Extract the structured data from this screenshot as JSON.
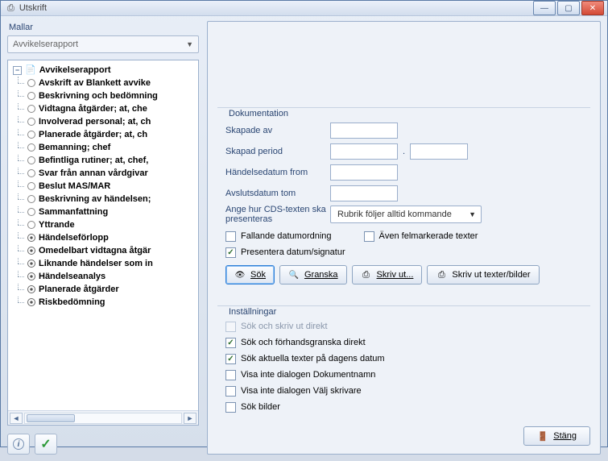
{
  "window": {
    "title": "Utskrift"
  },
  "mallar": {
    "label": "Mallar",
    "selected": "Avvikelserapport"
  },
  "tree": {
    "root": "Avvikelserapport",
    "items": [
      "Avskrift av Blankett avvike",
      "Beskrivning och bedömning",
      "Vidtagna åtgärder; at, che",
      "Involverad personal; at, ch",
      "Planerade åtgärder; at, ch",
      "Bemanning; chef",
      "Befintliga rutiner; at, chef,",
      "Svar från annan vårdgivar",
      "Beslut MAS/MAR",
      "Beskrivning av händelsen;",
      "Sammanfattning",
      "Yttrande",
      "Händelseförlopp",
      "Omedelbart vidtagna åtgär",
      "Liknande händelser som in",
      "Händelseanalys",
      "Planerade åtgärder",
      "Riskbedömning"
    ],
    "eye_indices": [
      12,
      13,
      14,
      15,
      16,
      17
    ]
  },
  "dok": {
    "group": "Dokumentation",
    "skapade_av": "Skapade av",
    "skapad_period": "Skapad period",
    "handelsedatum": "Händelsedatum from",
    "avslut": "Avslutsdatum tom",
    "cds_label": "Ange hur CDS-texten ska presenteras",
    "cds_value": "Rubrik följer alltid kommande",
    "fallande": "Fallande datumordning",
    "aven": "Även felmarkerade texter",
    "presentera": "Presentera datum/signatur"
  },
  "buttons": {
    "sok": "Sök",
    "granska": "Granska",
    "skrivut": "Skriv ut...",
    "skrivut_tb": "Skriv ut texter/bilder",
    "stang": "Stäng"
  },
  "inst": {
    "group": "Inställningar",
    "i1": "Sök och skriv ut direkt",
    "i2": "Sök och förhandsgranska direkt",
    "i3": "Sök aktuella texter på dagens datum",
    "i4": "Visa inte dialogen Dokumentnamn",
    "i5": "Visa inte dialogen Välj skrivare",
    "i6": "Sök bilder"
  }
}
